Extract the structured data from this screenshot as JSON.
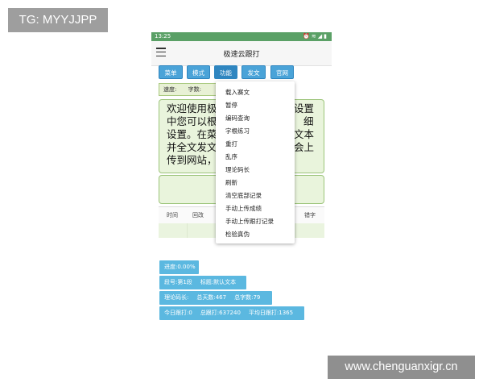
{
  "overlays": {
    "top_left": "TG: MYYJJPP",
    "bottom_right": "www.chenguanxigr.cn"
  },
  "statusbar": {
    "time": "13:25",
    "icons": [
      "alarm-icon",
      "wifi-icon",
      "signal-icon",
      "battery-icon"
    ]
  },
  "appbar": {
    "title": "极速云跟打"
  },
  "toolbar": {
    "buttons": [
      "菜单",
      "模式",
      "功能",
      "发文",
      "官网"
    ]
  },
  "infobar": {
    "speed_label": "速度:",
    "chars_label": "字数:"
  },
  "text_area": {
    "line1_a": "欢迎使用极",
    "line1_b": "设置",
    "line2_a": "中您可以根",
    "line2_b": "细",
    "line3_a": "设置。在菜",
    "line3_b": "文本",
    "line4_a": "并全文发文",
    "line4_b": "会上",
    "line5_a": "传到网站，"
  },
  "table": {
    "headers": [
      "时间",
      "回改",
      "错字"
    ]
  },
  "dropdown": {
    "items": [
      "载入赛文",
      "暂停",
      "编码查询",
      "字根练习",
      "重打",
      "乱序",
      "理论码长",
      "刷新",
      "清空底部记录",
      "手动上传成绩",
      "手动上传跟打记录",
      "检验真伪"
    ]
  },
  "stats": {
    "progress": "进度:0.00%",
    "segment": "段号:第1段",
    "title": "标题:默认文本",
    "theory_len": "理论码长:",
    "total_days": "总天数:467",
    "total_chars": "总字数:79",
    "today": "今日跟打:0",
    "total_typed": "总跟打:637240",
    "avg_daily": "平均日跟打:1365"
  },
  "colors": {
    "statusbar": "#5aa066",
    "button": "#4aa3d8",
    "chip": "#5bb8e0",
    "text_bg": "#e9f4dc"
  }
}
